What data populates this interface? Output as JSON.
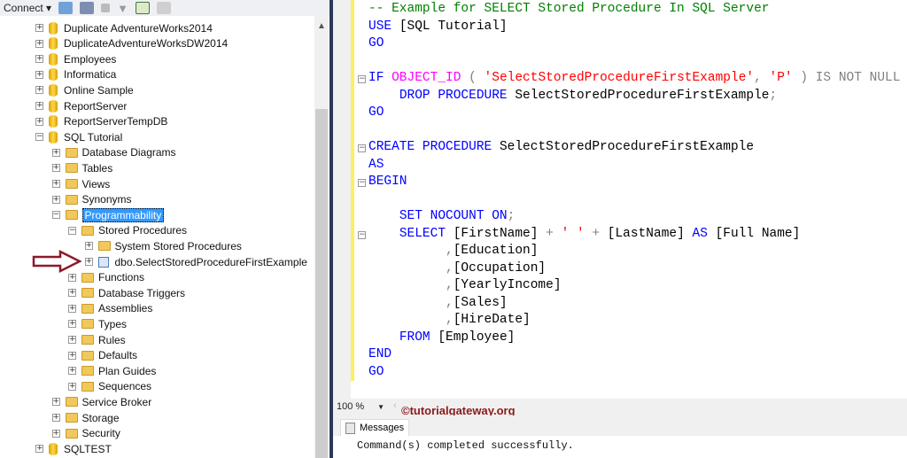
{
  "toolbar": {
    "connect_label": "Connect"
  },
  "tree": [
    {
      "label": "Duplicate AdventureWorks2014",
      "level": 0,
      "type": "db",
      "expanded": false
    },
    {
      "label": "DuplicateAdventureWorksDW2014",
      "level": 0,
      "type": "db",
      "expanded": false
    },
    {
      "label": "Employees",
      "level": 0,
      "type": "db",
      "expanded": false
    },
    {
      "label": "Informatica",
      "level": 0,
      "type": "db",
      "expanded": false
    },
    {
      "label": "Online Sample",
      "level": 0,
      "type": "db",
      "expanded": false
    },
    {
      "label": "ReportServer",
      "level": 0,
      "type": "db",
      "expanded": false
    },
    {
      "label": "ReportServerTempDB",
      "level": 0,
      "type": "db",
      "expanded": false
    },
    {
      "label": "SQL Tutorial",
      "level": 0,
      "type": "db",
      "expanded": true
    },
    {
      "label": "Database Diagrams",
      "level": 1,
      "type": "folder",
      "expanded": false
    },
    {
      "label": "Tables",
      "level": 1,
      "type": "folder",
      "expanded": false
    },
    {
      "label": "Views",
      "level": 1,
      "type": "folder",
      "expanded": false
    },
    {
      "label": "Synonyms",
      "level": 1,
      "type": "folder",
      "expanded": false
    },
    {
      "label": "Programmability",
      "level": 1,
      "type": "folder",
      "expanded": true,
      "selected": true
    },
    {
      "label": "Stored Procedures",
      "level": 2,
      "type": "folder",
      "expanded": true
    },
    {
      "label": "System Stored Procedures",
      "level": 3,
      "type": "folder",
      "expanded": false
    },
    {
      "label": "dbo.SelectStoredProcedureFirstExample",
      "level": 3,
      "type": "proc",
      "expanded": false
    },
    {
      "label": "Functions",
      "level": 2,
      "type": "folder",
      "expanded": false
    },
    {
      "label": "Database Triggers",
      "level": 2,
      "type": "folder",
      "expanded": false
    },
    {
      "label": "Assemblies",
      "level": 2,
      "type": "folder",
      "expanded": false
    },
    {
      "label": "Types",
      "level": 2,
      "type": "folder",
      "expanded": false
    },
    {
      "label": "Rules",
      "level": 2,
      "type": "folder",
      "expanded": false
    },
    {
      "label": "Defaults",
      "level": 2,
      "type": "folder",
      "expanded": false
    },
    {
      "label": "Plan Guides",
      "level": 2,
      "type": "folder",
      "expanded": false
    },
    {
      "label": "Sequences",
      "level": 2,
      "type": "folder",
      "expanded": false
    },
    {
      "label": "Service Broker",
      "level": 1,
      "type": "folder",
      "expanded": false
    },
    {
      "label": "Storage",
      "level": 1,
      "type": "folder",
      "expanded": false
    },
    {
      "label": "Security",
      "level": 1,
      "type": "folder",
      "expanded": false
    },
    {
      "label": "SQLTEST",
      "level": 0,
      "type": "db",
      "expanded": false
    }
  ],
  "code": [
    {
      "fold": false,
      "tokens": [
        [
          "cm",
          "-- Example for SELECT Stored Procedure In SQL Server"
        ]
      ]
    },
    {
      "fold": false,
      "tokens": [
        [
          "kw",
          "USE "
        ],
        [
          "id",
          "[SQL Tutorial]"
        ]
      ]
    },
    {
      "fold": false,
      "tokens": [
        [
          "kw",
          "GO"
        ]
      ]
    },
    {
      "fold": false,
      "tokens": []
    },
    {
      "fold": true,
      "tokens": [
        [
          "kw",
          "IF "
        ],
        [
          "fn",
          "OBJECT_ID"
        ],
        [
          "gr",
          " ( "
        ],
        [
          "st",
          "'SelectStoredProcedureFirstExample'"
        ],
        [
          "gr",
          ", "
        ],
        [
          "st",
          "'P'"
        ],
        [
          "gr",
          " ) IS NOT NULL"
        ]
      ]
    },
    {
      "fold": false,
      "tokens": [
        [
          "id",
          "    "
        ],
        [
          "kw",
          "DROP PROCEDURE "
        ],
        [
          "id",
          "SelectStoredProcedureFirstExample"
        ],
        [
          "gr",
          ";"
        ]
      ]
    },
    {
      "fold": false,
      "tokens": [
        [
          "kw",
          "GO"
        ]
      ]
    },
    {
      "fold": false,
      "tokens": []
    },
    {
      "fold": true,
      "tokens": [
        [
          "kw",
          "CREATE PROCEDURE "
        ],
        [
          "id",
          "SelectStoredProcedureFirstExample"
        ]
      ]
    },
    {
      "fold": false,
      "tokens": [
        [
          "kw",
          "AS"
        ]
      ]
    },
    {
      "fold": true,
      "tokens": [
        [
          "kw",
          "BEGIN"
        ]
      ]
    },
    {
      "fold": false,
      "tokens": []
    },
    {
      "fold": false,
      "tokens": [
        [
          "id",
          "    "
        ],
        [
          "kw",
          "SET NOCOUNT ON"
        ],
        [
          "gr",
          ";"
        ]
      ]
    },
    {
      "fold": true,
      "tokens": [
        [
          "id",
          "    "
        ],
        [
          "kw",
          "SELECT "
        ],
        [
          "id",
          "[FirstName] "
        ],
        [
          "gr",
          "+ "
        ],
        [
          "st",
          "' '"
        ],
        [
          "gr",
          " + "
        ],
        [
          "id",
          "[LastName] "
        ],
        [
          "kw",
          "AS "
        ],
        [
          "id",
          "[Full Name]"
        ]
      ]
    },
    {
      "fold": false,
      "tokens": [
        [
          "id",
          "          "
        ],
        [
          "gr",
          ","
        ],
        [
          "id",
          "[Education]"
        ]
      ]
    },
    {
      "fold": false,
      "tokens": [
        [
          "id",
          "          "
        ],
        [
          "gr",
          ","
        ],
        [
          "id",
          "[Occupation]"
        ]
      ]
    },
    {
      "fold": false,
      "tokens": [
        [
          "id",
          "          "
        ],
        [
          "gr",
          ","
        ],
        [
          "id",
          "[YearlyIncome]"
        ]
      ]
    },
    {
      "fold": false,
      "tokens": [
        [
          "id",
          "          "
        ],
        [
          "gr",
          ","
        ],
        [
          "id",
          "[Sales]"
        ]
      ]
    },
    {
      "fold": false,
      "tokens": [
        [
          "id",
          "          "
        ],
        [
          "gr",
          ","
        ],
        [
          "id",
          "[HireDate]"
        ]
      ]
    },
    {
      "fold": false,
      "tokens": [
        [
          "id",
          "    "
        ],
        [
          "kw",
          "FROM "
        ],
        [
          "id",
          "[Employee]"
        ]
      ]
    },
    {
      "fold": false,
      "tokens": [
        [
          "kw",
          "END"
        ]
      ]
    },
    {
      "fold": false,
      "tokens": [
        [
          "kw",
          "GO"
        ]
      ]
    }
  ],
  "zoom": {
    "value": "100 %"
  },
  "watermark": "©tutorialgateway.org",
  "messages": {
    "tab_label": "Messages",
    "text": "Command(s) completed successfully."
  }
}
